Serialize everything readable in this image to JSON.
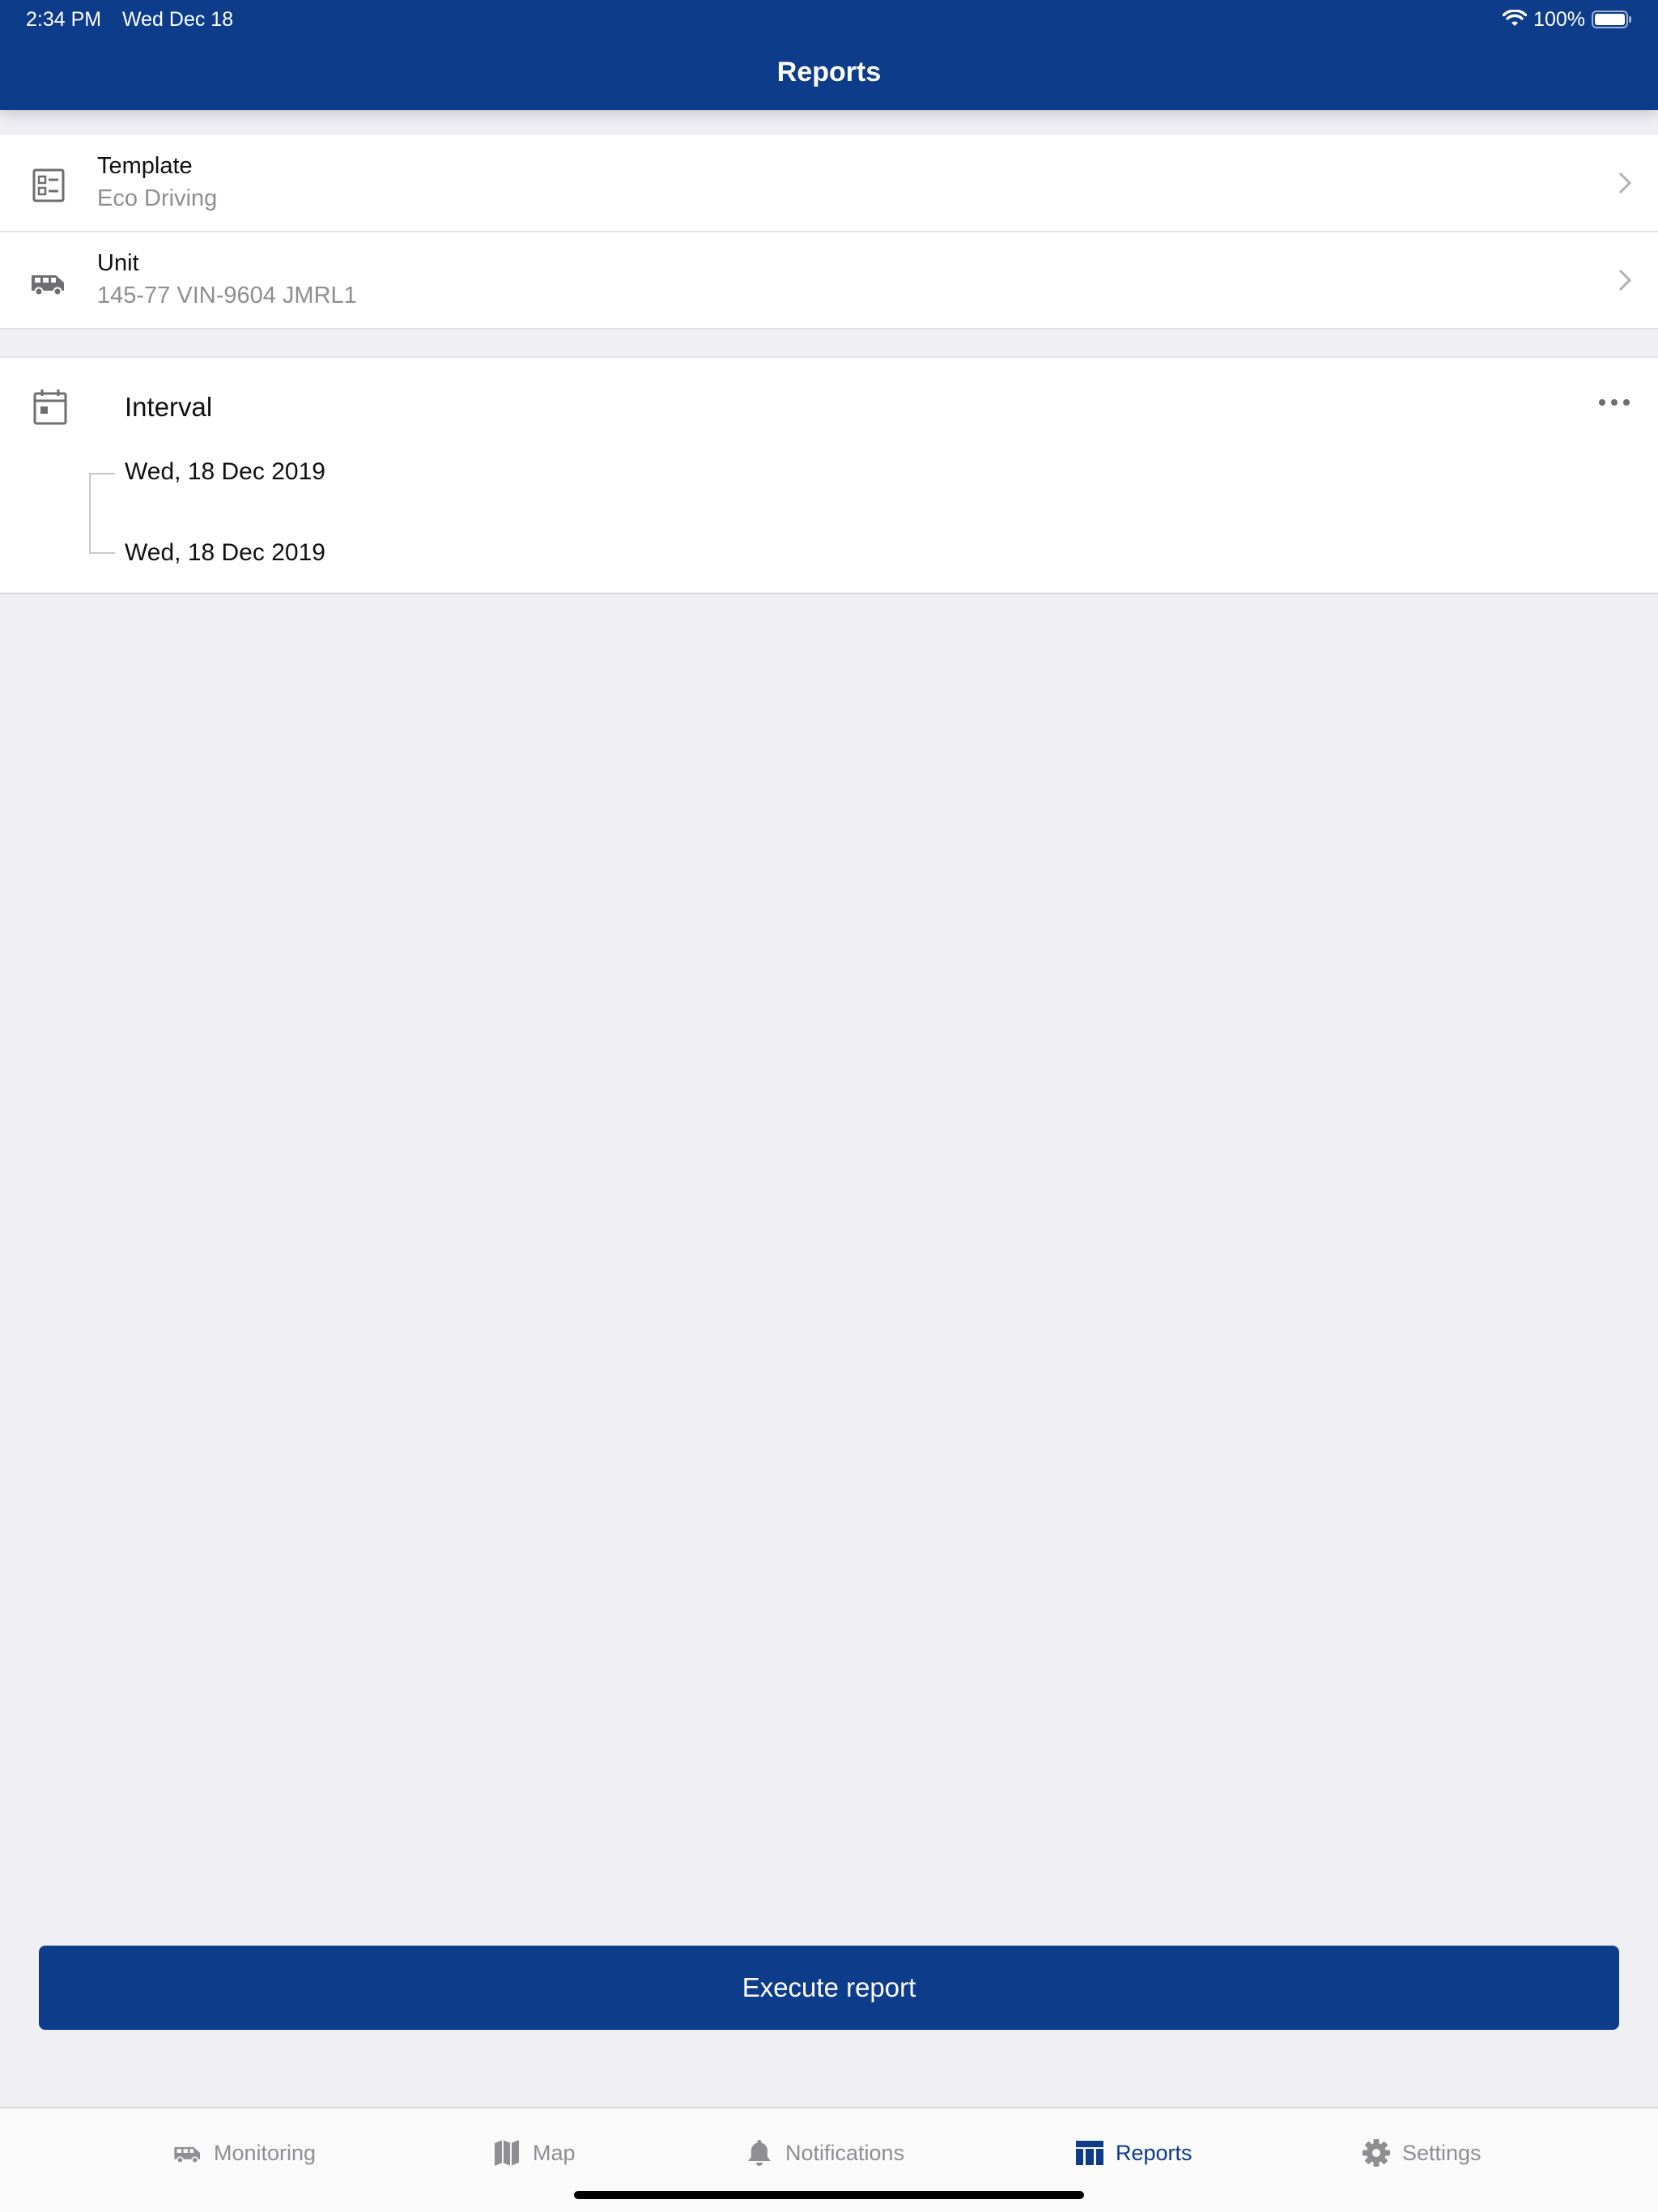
{
  "status_bar": {
    "time": "2:34 PM",
    "date": "Wed Dec 18",
    "battery": "100%"
  },
  "header": {
    "title": "Reports"
  },
  "template_row": {
    "label": "Template",
    "value": "Eco Driving",
    "icon": "template-icon"
  },
  "unit_row": {
    "label": "Unit",
    "value": "145-77 VIN-9604  JMRL1",
    "icon": "van-icon"
  },
  "interval": {
    "label": "Interval",
    "from": "Wed, 18 Dec 2019",
    "to": "Wed, 18 Dec 2019",
    "icon": "calendar-icon"
  },
  "execute_button": {
    "label": "Execute report"
  },
  "tabs": [
    {
      "label": "Monitoring",
      "icon": "van-icon"
    },
    {
      "label": "Map",
      "icon": "map-icon"
    },
    {
      "label": "Notifications",
      "icon": "bell-icon"
    },
    {
      "label": "Reports",
      "icon": "reports-icon",
      "active": true
    },
    {
      "label": "Settings",
      "icon": "gear-icon"
    }
  ],
  "colors": {
    "brand": "#0D3C8B",
    "background": "#EFEFF4",
    "secondary_text": "#8E8E93"
  }
}
